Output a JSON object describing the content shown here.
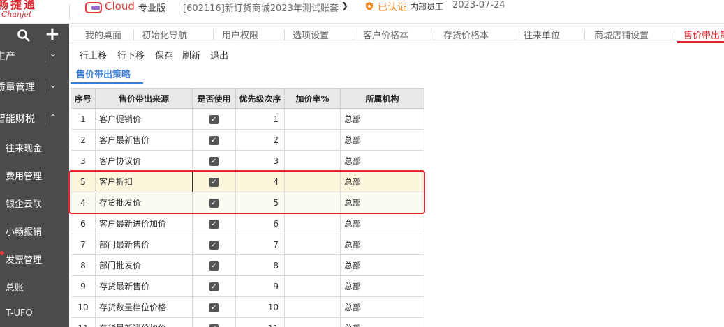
{
  "header": {
    "logo_cn": "畅捷通",
    "logo_en": "Chanjet",
    "product": "Cloud",
    "edition": "专业版",
    "account": "[602116]新订货商城2023年测试账套",
    "cert": "已认证",
    "staff": "内部员工",
    "date": "2023-07-24",
    "colors": {
      "brand": "#d9262c",
      "cert": "#f08a24"
    }
  },
  "sidebar": {
    "groups": [
      {
        "label": "生产"
      },
      {
        "label": "质量管理"
      },
      {
        "label": "智能财税"
      }
    ],
    "items": [
      {
        "label": "往来现金"
      },
      {
        "label": "费用管理"
      },
      {
        "label": "银企云联"
      },
      {
        "label": "小畅报销"
      },
      {
        "label": "发票管理"
      },
      {
        "label": "总账"
      },
      {
        "label": "T-UFO"
      }
    ]
  },
  "tabs": [
    {
      "label": "我的桌面"
    },
    {
      "label": "初始化导航"
    },
    {
      "label": "用户权限"
    },
    {
      "label": "选项设置"
    },
    {
      "label": "客户价格本"
    },
    {
      "label": "存货价格本"
    },
    {
      "label": "往来单位"
    },
    {
      "label": "商城店铺设置"
    },
    {
      "label": "售价带出策略"
    }
  ],
  "toolbar": {
    "move_up": "行上移",
    "move_down": "行下移",
    "save": "保存",
    "refresh": "刷新",
    "exit": "退出"
  },
  "subtab": {
    "label": "售价带出策略"
  },
  "table": {
    "headers": [
      "序号",
      "售价带出来源",
      "是否使用",
      "优先级次序",
      "加价率%",
      "所属机构"
    ],
    "rows": [
      {
        "no": "1",
        "source": "客户促销价",
        "used": true,
        "priority": "1",
        "markup": "",
        "org": "总部"
      },
      {
        "no": "2",
        "source": "客户最新售价",
        "used": true,
        "priority": "2",
        "markup": "",
        "org": "总部"
      },
      {
        "no": "3",
        "source": "客户协议价",
        "used": true,
        "priority": "3",
        "markup": "",
        "org": "总部"
      },
      {
        "no": "5",
        "source": "客户折扣",
        "used": true,
        "priority": "4",
        "markup": "",
        "org": "总部"
      },
      {
        "no": "4",
        "source": "存货批发价",
        "used": true,
        "priority": "5",
        "markup": "",
        "org": "总部"
      },
      {
        "no": "6",
        "source": "客户最新进价加价",
        "used": true,
        "priority": "6",
        "markup": "",
        "org": "总部"
      },
      {
        "no": "7",
        "source": "部门最新售价",
        "used": true,
        "priority": "7",
        "markup": "",
        "org": "总部"
      },
      {
        "no": "8",
        "source": "部门批发价",
        "used": true,
        "priority": "8",
        "markup": "",
        "org": "总部"
      },
      {
        "no": "9",
        "source": "存货最新售价",
        "used": true,
        "priority": "9",
        "markup": "",
        "org": "总部"
      },
      {
        "no": "10",
        "source": "存货数量档位价格",
        "used": true,
        "priority": "10",
        "markup": "",
        "org": "总部"
      },
      {
        "no": "11",
        "source": "存货最新进价加价",
        "used": true,
        "priority": "11",
        "markup": "",
        "org": "总部"
      }
    ],
    "checkmark": "✓"
  }
}
